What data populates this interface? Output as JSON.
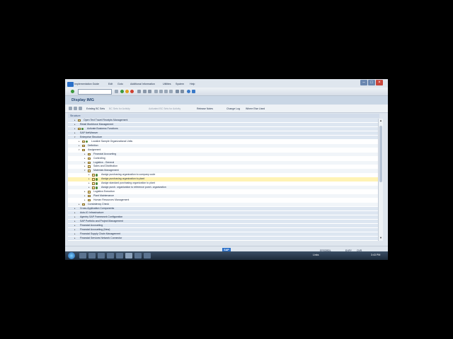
{
  "menu": [
    "Implementation Guide",
    "Edit",
    "Goto",
    "Additional Information",
    "Utilities",
    "System",
    "Help"
  ],
  "title": "Display IMG",
  "toolbar": {
    "existing_bc_sets": "Existing BC Sets",
    "bc_sets_activity": "BC Sets for Activity",
    "activated_bc_sets": "Activated BC Sets for Activity",
    "release_notes": "Release Notes",
    "change_log": "Change Log",
    "where_else_used": "Where Else Used"
  },
  "structure_header": "Structure",
  "tree": [
    {
      "label": "Open Text Travel Receipts Management",
      "level": 1,
      "kind": "folder",
      "style": "grp"
    },
    {
      "label": "Retail Workforce Management",
      "level": 1,
      "kind": "none",
      "style": "grp"
    },
    {
      "label": "Activate Business Functions",
      "level": 1,
      "kind": "both",
      "style": "grp"
    },
    {
      "label": "SAP NetWeaver",
      "level": 1,
      "kind": "none",
      "style": "grp"
    },
    {
      "label": "Enterprise Structure",
      "level": 1,
      "kind": "none",
      "style": "grp",
      "expanded": true
    },
    {
      "label": "Localize Sample Organizational Units",
      "level": 2,
      "kind": "both",
      "style": ""
    },
    {
      "label": "Definition",
      "level": 2,
      "kind": "folder",
      "style": "alt"
    },
    {
      "label": "Assignment",
      "level": 2,
      "kind": "folder",
      "style": "",
      "expanded": true
    },
    {
      "label": "Financial Accounting",
      "level": 3,
      "kind": "folder",
      "style": "alt"
    },
    {
      "label": "Controlling",
      "level": 3,
      "kind": "folder",
      "style": ""
    },
    {
      "label": "Logistics - General",
      "level": 3,
      "kind": "folder",
      "style": "alt"
    },
    {
      "label": "Sales and Distribution",
      "level": 3,
      "kind": "folder",
      "style": ""
    },
    {
      "label": "Materials Management",
      "level": 3,
      "kind": "folder",
      "style": "alt",
      "expanded": true
    },
    {
      "label": "Assign purchasing organization to company code",
      "level": 4,
      "kind": "both",
      "style": ""
    },
    {
      "label": "Assign purchasing organization to plant",
      "level": 4,
      "kind": "both",
      "style": "sel"
    },
    {
      "label": "Assign standard purchasing organization to plant",
      "level": 4,
      "kind": "both",
      "style": ""
    },
    {
      "label": "Assign purch. organization to reference purch. organization",
      "level": 4,
      "kind": "both",
      "style": "alt"
    },
    {
      "label": "Logistics Execution",
      "level": 3,
      "kind": "folder",
      "style": ""
    },
    {
      "label": "Plant Maintenance",
      "level": 3,
      "kind": "folder",
      "style": "alt"
    },
    {
      "label": "Human Resources Management",
      "level": 3,
      "kind": "folder",
      "style": ""
    },
    {
      "label": "Consistency Check",
      "level": 2,
      "kind": "folder",
      "style": "alt"
    },
    {
      "label": "Cross-Application Components",
      "level": 1,
      "kind": "none",
      "style": "grp"
    },
    {
      "label": "Auto-ID Infrastructure",
      "level": 1,
      "kind": "none",
      "style": "grp"
    },
    {
      "label": "Agentry SAP Framework Configuration",
      "level": 1,
      "kind": "none",
      "style": "grp"
    },
    {
      "label": "SAP Portfolio and Project Management",
      "level": 1,
      "kind": "none",
      "style": "grp"
    },
    {
      "label": "Financial Accounting",
      "level": 1,
      "kind": "none",
      "style": "grp"
    },
    {
      "label": "Financial Accounting (New)",
      "level": 1,
      "kind": "none",
      "style": "grp"
    },
    {
      "label": "Financial Supply Chain Management",
      "level": 1,
      "kind": "none",
      "style": "grp"
    },
    {
      "label": "Financial Services Network Connector",
      "level": 1,
      "kind": "none",
      "style": "grp"
    }
  ],
  "status": {
    "sap": "SAP",
    "system": "ERSQBDL",
    "client": "EHPY",
    "mode": "OVR"
  },
  "taskbar": {
    "links": "Links",
    "time": "3:43 PM"
  }
}
